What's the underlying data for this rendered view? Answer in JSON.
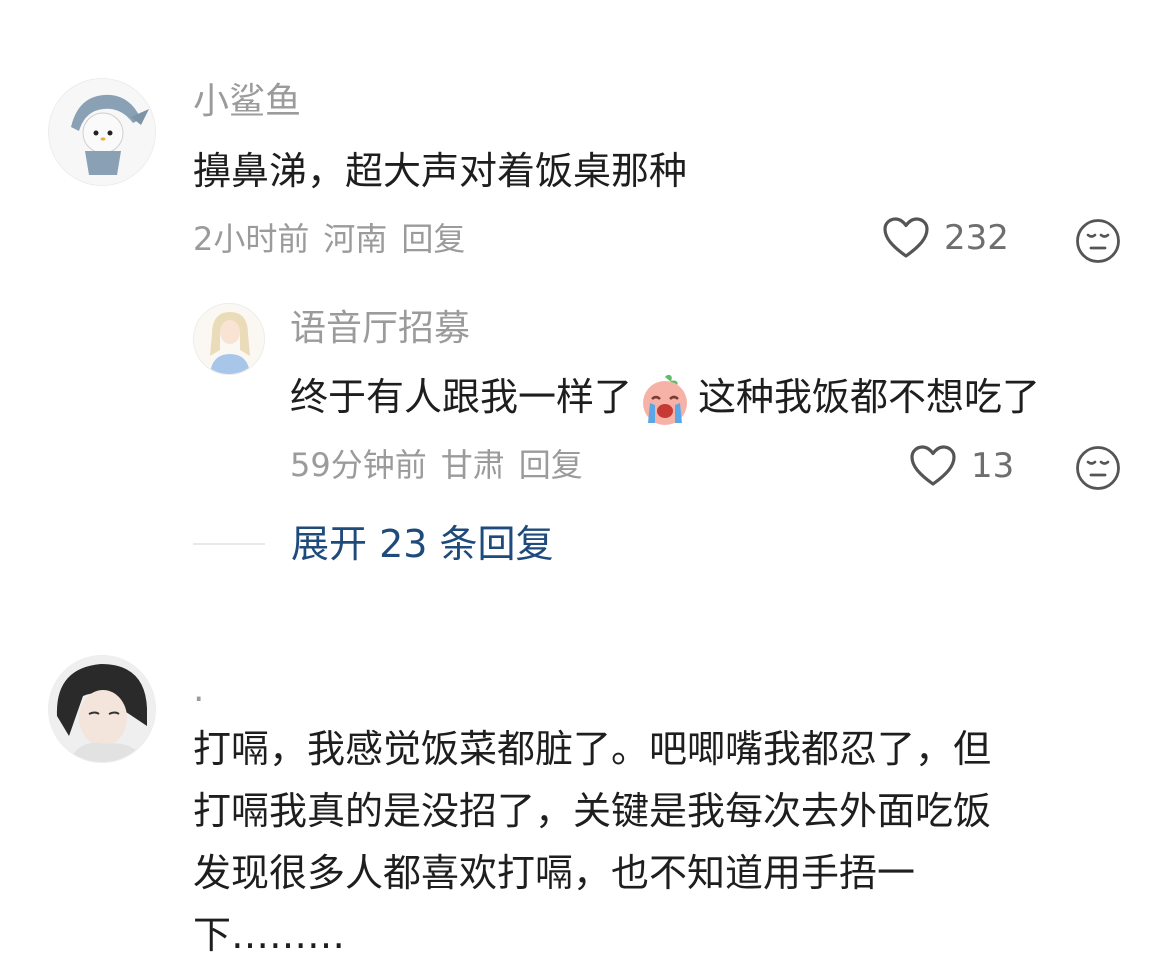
{
  "comments": [
    {
      "author": "小鲨鱼",
      "text": "擤鼻涕，超大声对着饭桌那种",
      "time": "2小时前",
      "location": "河南",
      "reply_label": "回复",
      "likes": "232",
      "avatar_icon": "shark-costume-avatar",
      "replies": [
        {
          "author": "语音厅招募",
          "text_before": "终于有人跟我一样了",
          "emoji": "crying-face-sticker",
          "text_after": "这种我饭都不想吃了",
          "time": "59分钟前",
          "location": "甘肃",
          "reply_label": "回复",
          "likes": "13",
          "avatar_icon": "illustrated-girl-avatar"
        }
      ],
      "expand_label": "展开 23 条回复"
    },
    {
      "author": ".",
      "avatar_icon": "girl-photo-avatar",
      "text_lines": [
        "打嗝，我感觉饭菜都脏了。吧唧嘴我都忍了，但",
        "打嗝我真的是没招了，关键是我每次去外面吃饭",
        "发现很多人都喜欢打嗝，也不知道用手捂一",
        "下………"
      ]
    }
  ],
  "colors": {
    "link": "#1f4a7c",
    "meta": "#9b9b9b",
    "text": "#1e1e1e"
  }
}
